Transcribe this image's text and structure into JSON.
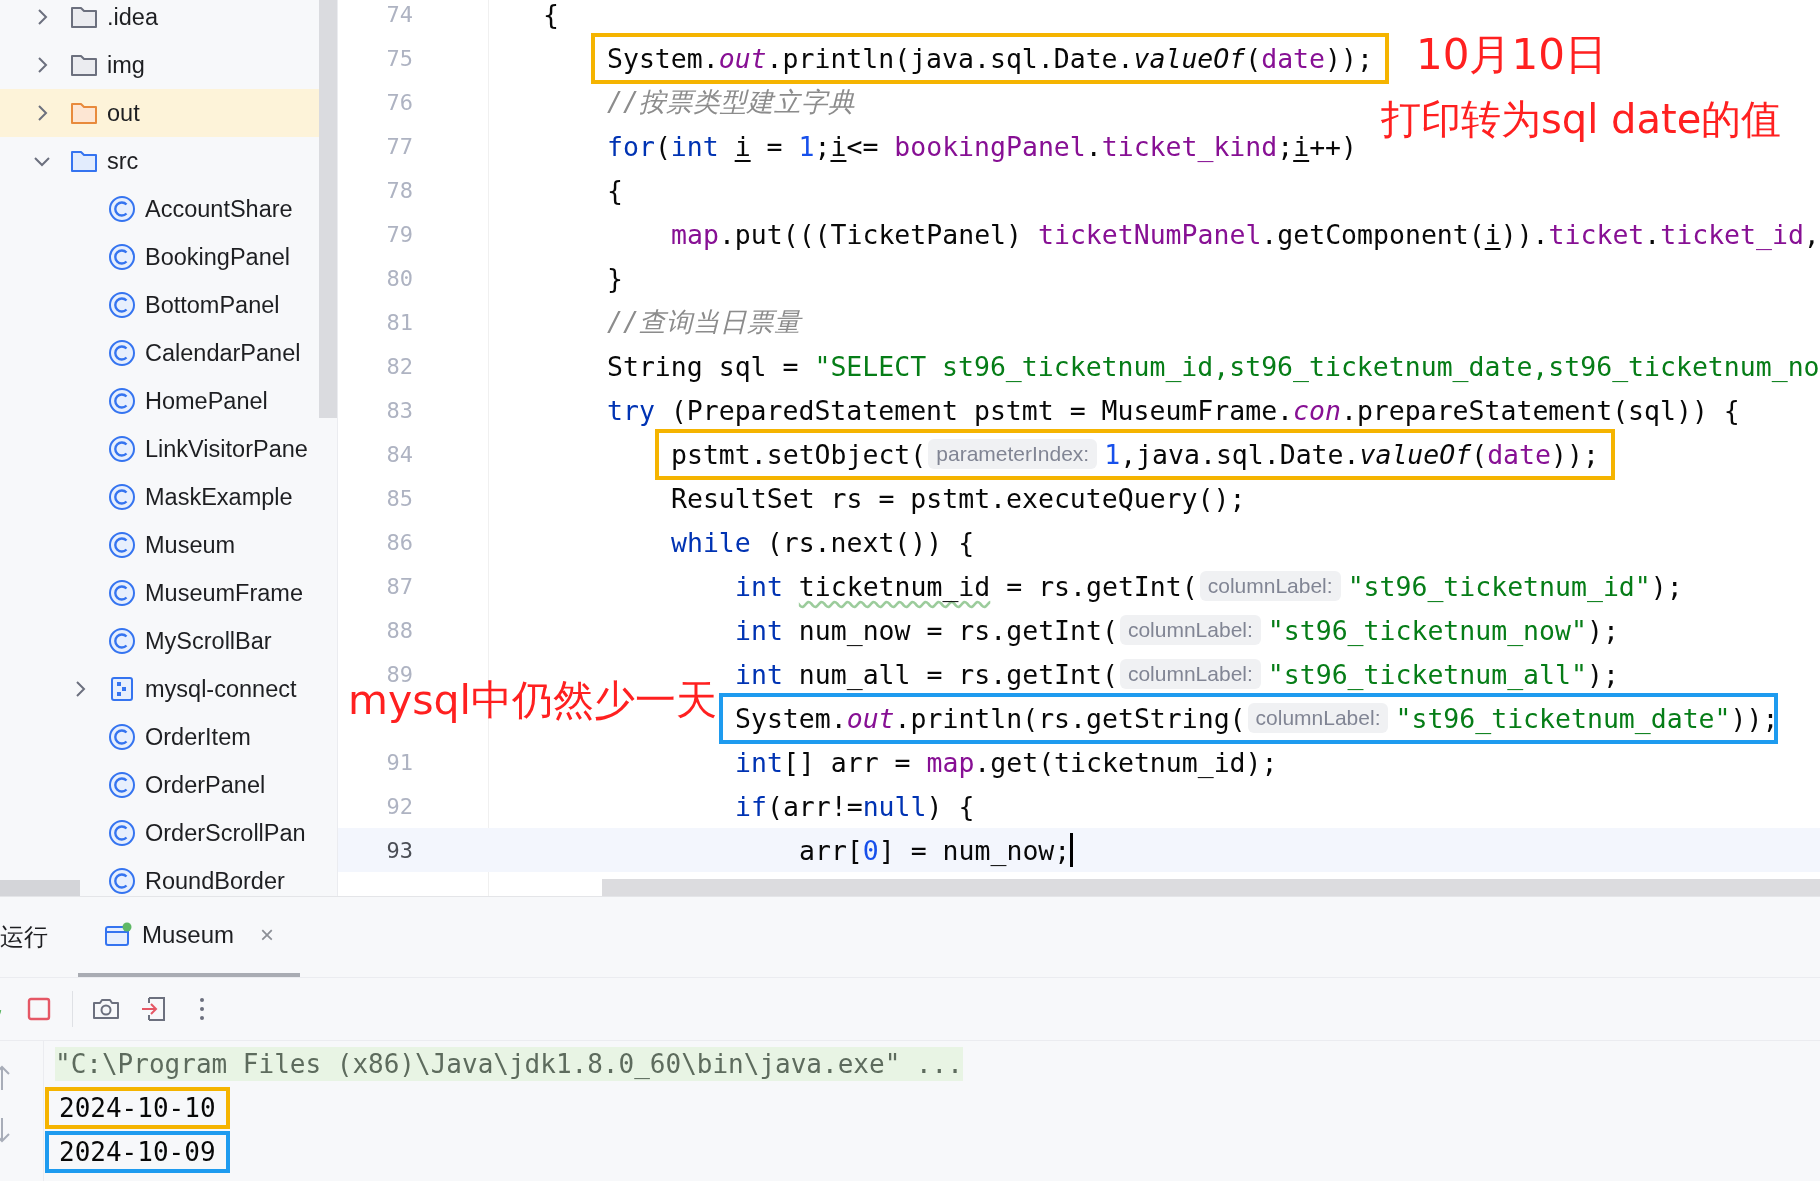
{
  "project_tree": [
    {
      "kind": "folder",
      "label": ".idea",
      "expanded": false,
      "selected": false
    },
    {
      "kind": "folder",
      "label": "img",
      "expanded": false,
      "selected": false
    },
    {
      "kind": "excluded-folder",
      "label": "out",
      "expanded": false,
      "selected": true
    },
    {
      "kind": "source-folder",
      "label": "src",
      "expanded": true,
      "selected": false,
      "children": [
        {
          "kind": "class",
          "label": "AccountShare",
          "selected": false
        },
        {
          "kind": "class",
          "label": "BookingPanel",
          "selected": false
        },
        {
          "kind": "class",
          "label": "BottomPanel",
          "selected": false
        },
        {
          "kind": "class",
          "label": "CalendarPanel",
          "selected": false
        },
        {
          "kind": "class",
          "label": "HomePanel",
          "selected": false
        },
        {
          "kind": "class",
          "label": "LinkVisitorPane",
          "selected": false
        },
        {
          "kind": "class",
          "label": "MaskExample",
          "selected": false
        },
        {
          "kind": "class",
          "label": "Museum",
          "selected": false
        },
        {
          "kind": "class",
          "label": "MuseumFrame",
          "selected": false
        },
        {
          "kind": "class",
          "label": "MyScrollBar",
          "selected": false
        },
        {
          "kind": "library",
          "label": "mysql-connect",
          "expanded": false,
          "selected": false
        },
        {
          "kind": "class",
          "label": "OrderItem",
          "selected": false
        },
        {
          "kind": "class",
          "label": "OrderPanel",
          "selected": false
        },
        {
          "kind": "class",
          "label": "OrderScrollPan",
          "selected": false
        },
        {
          "kind": "class",
          "label": "RoundBorder",
          "selected": false
        }
      ]
    }
  ],
  "editor": {
    "lines": [
      {
        "number": "74",
        "current": false,
        "parts": [
          {
            "kind": "code",
            "tokens": [
              {
                "kind": "p",
                "text": "{"
              }
            ]
          }
        ],
        "children": [
          {
            "number": "75",
            "current": false,
            "parts": [
              {
                "kind": "box",
                "color": "#f5b400",
                "parts": [
                  {
                    "kind": "code",
                    "tokens": [
                      {
                        "kind": "p",
                        "text": "System."
                      },
                      {
                        "kind": "fi",
                        "text": "out"
                      },
                      {
                        "kind": "p",
                        "text": ".println(java.sql.Date."
                      },
                      {
                        "kind": "mi",
                        "text": "valueOf"
                      },
                      {
                        "kind": "p",
                        "text": "("
                      },
                      {
                        "kind": "f",
                        "text": "date"
                      },
                      {
                        "kind": "p",
                        "text": "));"
                      }
                    ]
                  }
                ]
              }
            ]
          },
          {
            "number": "76",
            "current": false,
            "parts": [
              {
                "kind": "code",
                "tokens": [
                  {
                    "kind": "c",
                    "text": "//按票类型建立字典"
                  }
                ]
              }
            ]
          },
          {
            "number": "77",
            "current": false,
            "parts": [
              {
                "kind": "code",
                "tokens": [
                  {
                    "kind": "kw",
                    "text": "for"
                  },
                  {
                    "kind": "p",
                    "text": "("
                  },
                  {
                    "kind": "kw",
                    "text": "int "
                  },
                  {
                    "kind": "u",
                    "text": "i"
                  },
                  {
                    "kind": "p",
                    "text": " = "
                  },
                  {
                    "kind": "n",
                    "text": "1"
                  },
                  {
                    "kind": "p",
                    "text": ";"
                  },
                  {
                    "kind": "u",
                    "text": "i"
                  },
                  {
                    "kind": "p",
                    "text": "<= "
                  },
                  {
                    "kind": "f",
                    "text": "bookingPanel"
                  },
                  {
                    "kind": "p",
                    "text": "."
                  },
                  {
                    "kind": "f",
                    "text": "ticket_kind"
                  },
                  {
                    "kind": "p",
                    "text": ";"
                  },
                  {
                    "kind": "u",
                    "text": "i"
                  },
                  {
                    "kind": "p",
                    "text": "++)"
                  }
                ]
              }
            ]
          },
          {
            "number": "78",
            "current": false,
            "parts": [
              {
                "kind": "code",
                "tokens": [
                  {
                    "kind": "p",
                    "text": "{"
                  }
                ]
              }
            ],
            "children": [
              {
                "number": "79",
                "current": false,
                "parts": [
                  {
                    "kind": "code",
                    "tokens": [
                      {
                        "kind": "f",
                        "text": "map"
                      },
                      {
                        "kind": "p",
                        "text": ".put(((TicketPanel) "
                      },
                      {
                        "kind": "f",
                        "text": "ticketNumPanel"
                      },
                      {
                        "kind": "p",
                        "text": ".getComponent("
                      },
                      {
                        "kind": "u",
                        "text": "i"
                      },
                      {
                        "kind": "p",
                        "text": "))."
                      },
                      {
                        "kind": "f",
                        "text": "ticket"
                      },
                      {
                        "kind": "p",
                        "text": "."
                      },
                      {
                        "kind": "f",
                        "text": "ticket_id"
                      },
                      {
                        "kind": "p",
                        "text": ","
                      }
                    ]
                  }
                ]
              }
            ]
          },
          {
            "number": "80",
            "current": false,
            "parts": [
              {
                "kind": "code",
                "tokens": [
                  {
                    "kind": "p",
                    "text": "}"
                  }
                ]
              }
            ]
          },
          {
            "number": "81",
            "current": false,
            "parts": [
              {
                "kind": "code",
                "tokens": [
                  {
                    "kind": "c",
                    "text": "//查询当日票量"
                  }
                ]
              }
            ]
          },
          {
            "number": "82",
            "current": false,
            "parts": [
              {
                "kind": "code",
                "tokens": [
                  {
                    "kind": "p",
                    "text": "String sql = "
                  },
                  {
                    "kind": "s",
                    "text": "\"SELECT st96_ticketnum_id,st96_ticketnum_date,st96_ticketnum_no"
                  }
                ]
              }
            ]
          },
          {
            "number": "83",
            "current": false,
            "parts": [
              {
                "kind": "code",
                "tokens": [
                  {
                    "kind": "kw",
                    "text": "try"
                  },
                  {
                    "kind": "p",
                    "text": " (PreparedStatement pstmt = MuseumFrame."
                  },
                  {
                    "kind": "fi",
                    "text": "con"
                  },
                  {
                    "kind": "p",
                    "text": ".prepareStatement(sql)) {"
                  }
                ]
              }
            ],
            "children": [
              {
                "number": "84",
                "current": false,
                "parts": [
                  {
                    "kind": "box",
                    "color": "#f5b400",
                    "parts": [
                      {
                        "kind": "code",
                        "tokens": [
                          {
                            "kind": "p",
                            "text": "pstmt.setObject("
                          }
                        ]
                      },
                      {
                        "kind": "hint",
                        "text": "parameterIndex:"
                      },
                      {
                        "kind": "code",
                        "tokens": [
                          {
                            "kind": "n",
                            "text": "1"
                          },
                          {
                            "kind": "p",
                            "text": ",java.sql.Date."
                          },
                          {
                            "kind": "mi",
                            "text": "valueOf"
                          },
                          {
                            "kind": "p",
                            "text": "("
                          },
                          {
                            "kind": "f",
                            "text": "date"
                          },
                          {
                            "kind": "p",
                            "text": "));"
                          }
                        ]
                      }
                    ]
                  }
                ]
              },
              {
                "number": "85",
                "current": false,
                "parts": [
                  {
                    "kind": "code",
                    "tokens": [
                      {
                        "kind": "p",
                        "text": "ResultSet rs = pstmt.executeQuery();"
                      }
                    ]
                  }
                ]
              },
              {
                "number": "86",
                "current": false,
                "parts": [
                  {
                    "kind": "code",
                    "tokens": [
                      {
                        "kind": "kw",
                        "text": "while"
                      },
                      {
                        "kind": "p",
                        "text": " (rs.next()) {"
                      }
                    ]
                  }
                ],
                "children": [
                  {
                    "number": "87",
                    "current": false,
                    "parts": [
                      {
                        "kind": "code",
                        "tokens": [
                          {
                            "kind": "kw",
                            "text": "int "
                          },
                          {
                            "kind": "w",
                            "text": "ticketnum_id"
                          },
                          {
                            "kind": "p",
                            "text": " = rs.getInt("
                          }
                        ]
                      },
                      {
                        "kind": "hint",
                        "text": "columnLabel:"
                      },
                      {
                        "kind": "code",
                        "tokens": [
                          {
                            "kind": "s",
                            "text": "\"st96_ticketnum_id\""
                          },
                          {
                            "kind": "p",
                            "text": ");"
                          }
                        ]
                      }
                    ]
                  },
                  {
                    "number": "88",
                    "current": false,
                    "parts": [
                      {
                        "kind": "code",
                        "tokens": [
                          {
                            "kind": "kw",
                            "text": "int"
                          },
                          {
                            "kind": "p",
                            "text": " num_now = rs.getInt("
                          }
                        ]
                      },
                      {
                        "kind": "hint",
                        "text": "columnLabel:"
                      },
                      {
                        "kind": "code",
                        "tokens": [
                          {
                            "kind": "s",
                            "text": "\"st96_ticketnum_now\""
                          },
                          {
                            "kind": "p",
                            "text": ");"
                          }
                        ]
                      }
                    ]
                  },
                  {
                    "number": "89",
                    "current": false,
                    "parts": [
                      {
                        "kind": "code",
                        "tokens": [
                          {
                            "kind": "kw",
                            "text": "int"
                          },
                          {
                            "kind": "p",
                            "text": " num_all = rs.getInt("
                          }
                        ]
                      },
                      {
                        "kind": "hint",
                        "text": "columnLabel:"
                      },
                      {
                        "kind": "code",
                        "tokens": [
                          {
                            "kind": "s",
                            "text": "\"st96_ticketnum_all\""
                          },
                          {
                            "kind": "p",
                            "text": ");"
                          }
                        ]
                      }
                    ]
                  },
                  {
                    "current": false,
                    "parts": [
                      {
                        "kind": "box",
                        "color": "#1e9bef",
                        "parts": [
                          {
                            "kind": "code",
                            "tokens": [
                              {
                                "kind": "p",
                                "text": "System."
                              },
                              {
                                "kind": "fi",
                                "text": "out"
                              },
                              {
                                "kind": "p",
                                "text": ".println(rs.getString("
                              }
                            ]
                          },
                          {
                            "kind": "hint",
                            "text": "columnLabel:"
                          },
                          {
                            "kind": "code",
                            "tokens": [
                              {
                                "kind": "s",
                                "text": "\"st96_ticketnum_date\""
                              },
                              {
                                "kind": "p",
                                "text": "))"
                              }
                            ]
                          }
                        ]
                      },
                      {
                        "kind": "code",
                        "tokens": [
                          {
                            "kind": "p",
                            "text": ";"
                          }
                        ]
                      }
                    ]
                  },
                  {
                    "number": "91",
                    "current": false,
                    "parts": [
                      {
                        "kind": "code",
                        "tokens": [
                          {
                            "kind": "kw",
                            "text": "int"
                          },
                          {
                            "kind": "p",
                            "text": "[] arr = "
                          },
                          {
                            "kind": "f",
                            "text": "map"
                          },
                          {
                            "kind": "p",
                            "text": ".get(ticketnum_id);"
                          }
                        ]
                      }
                    ]
                  },
                  {
                    "number": "92",
                    "current": false,
                    "parts": [
                      {
                        "kind": "code",
                        "tokens": [
                          {
                            "kind": "kw",
                            "text": "if"
                          },
                          {
                            "kind": "p",
                            "text": "(arr!="
                          },
                          {
                            "kind": "kw",
                            "text": "null"
                          },
                          {
                            "kind": "p",
                            "text": ") {"
                          }
                        ]
                      }
                    ],
                    "children": [
                      {
                        "number": "93",
                        "current": true,
                        "parts": [
                          {
                            "kind": "code",
                            "tokens": [
                              {
                                "kind": "p",
                                "text": "arr["
                              },
                              {
                                "kind": "n",
                                "text": "0"
                              },
                              {
                                "kind": "p",
                                "text": "] = num_now;"
                              }
                            ]
                          }
                        ]
                      }
                    ]
                  }
                ]
              }
            ]
          }
        ]
      }
    ]
  },
  "annotations": [
    {
      "text": "10月10日"
    },
    {
      "text": "打印转为sql date的值"
    },
    {
      "text": "mysql中仍然少一天"
    }
  ],
  "run_panel": {
    "label": "运行",
    "tabs": [
      {
        "label": "Museum",
        "close": "×",
        "selected": true
      }
    ],
    "console": [
      {
        "kind": "command",
        "text": "\"C:\\Program Files (x86)\\Java\\jdk1.8.0_60\\bin\\java.exe\" ..."
      },
      {
        "kind": "output",
        "text": "2024-10-10",
        "color": "#f5b400"
      },
      {
        "kind": "output",
        "text": "2024-10-09",
        "color": "#1e9bef"
      }
    ]
  }
}
